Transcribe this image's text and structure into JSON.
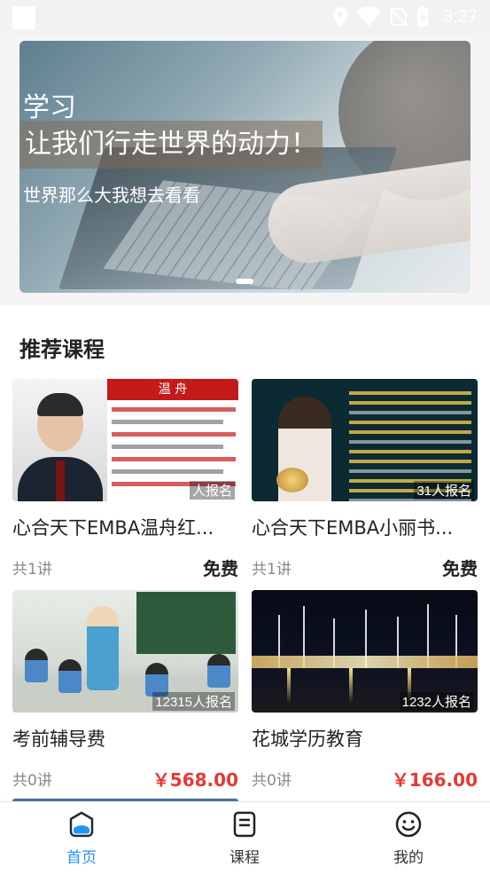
{
  "status_bar": {
    "time": "3:27",
    "icons": [
      "location-icon",
      "wifi-icon",
      "no-sim-icon",
      "battery-charging-icon"
    ]
  },
  "banner": {
    "title": "学习",
    "subtitle": "让我们行走世界的动力！",
    "tagline": "世界那么大我想去看看",
    "page_indicator": {
      "count": 1,
      "active": 0
    }
  },
  "section": {
    "title": "推荐课程"
  },
  "courses": [
    {
      "title": "心合天下EMBA温舟红...",
      "enrolled": "人报名",
      "lessons": "共1讲",
      "price": "免费",
      "thumb_header": "温 舟"
    },
    {
      "title": "心合天下EMBA小丽书...",
      "enrolled": "31人报名",
      "lessons": "共1讲",
      "price": "免费"
    },
    {
      "title": "考前辅导费",
      "enrolled": "12315人报名",
      "lessons": "共0讲",
      "price": "￥568.00"
    },
    {
      "title": "花城学历教育",
      "enrolled": "1232人报名",
      "lessons": "共0讲",
      "price": "￥166.00"
    }
  ],
  "tabbar": {
    "tabs": [
      {
        "label": "首页",
        "icon": "home-icon",
        "active": true
      },
      {
        "label": "课程",
        "icon": "course-book-icon",
        "active": false
      },
      {
        "label": "我的",
        "icon": "profile-smile-icon",
        "active": false
      }
    ]
  },
  "colors": {
    "accent": "#2196f3",
    "price_red": "#e53935"
  }
}
